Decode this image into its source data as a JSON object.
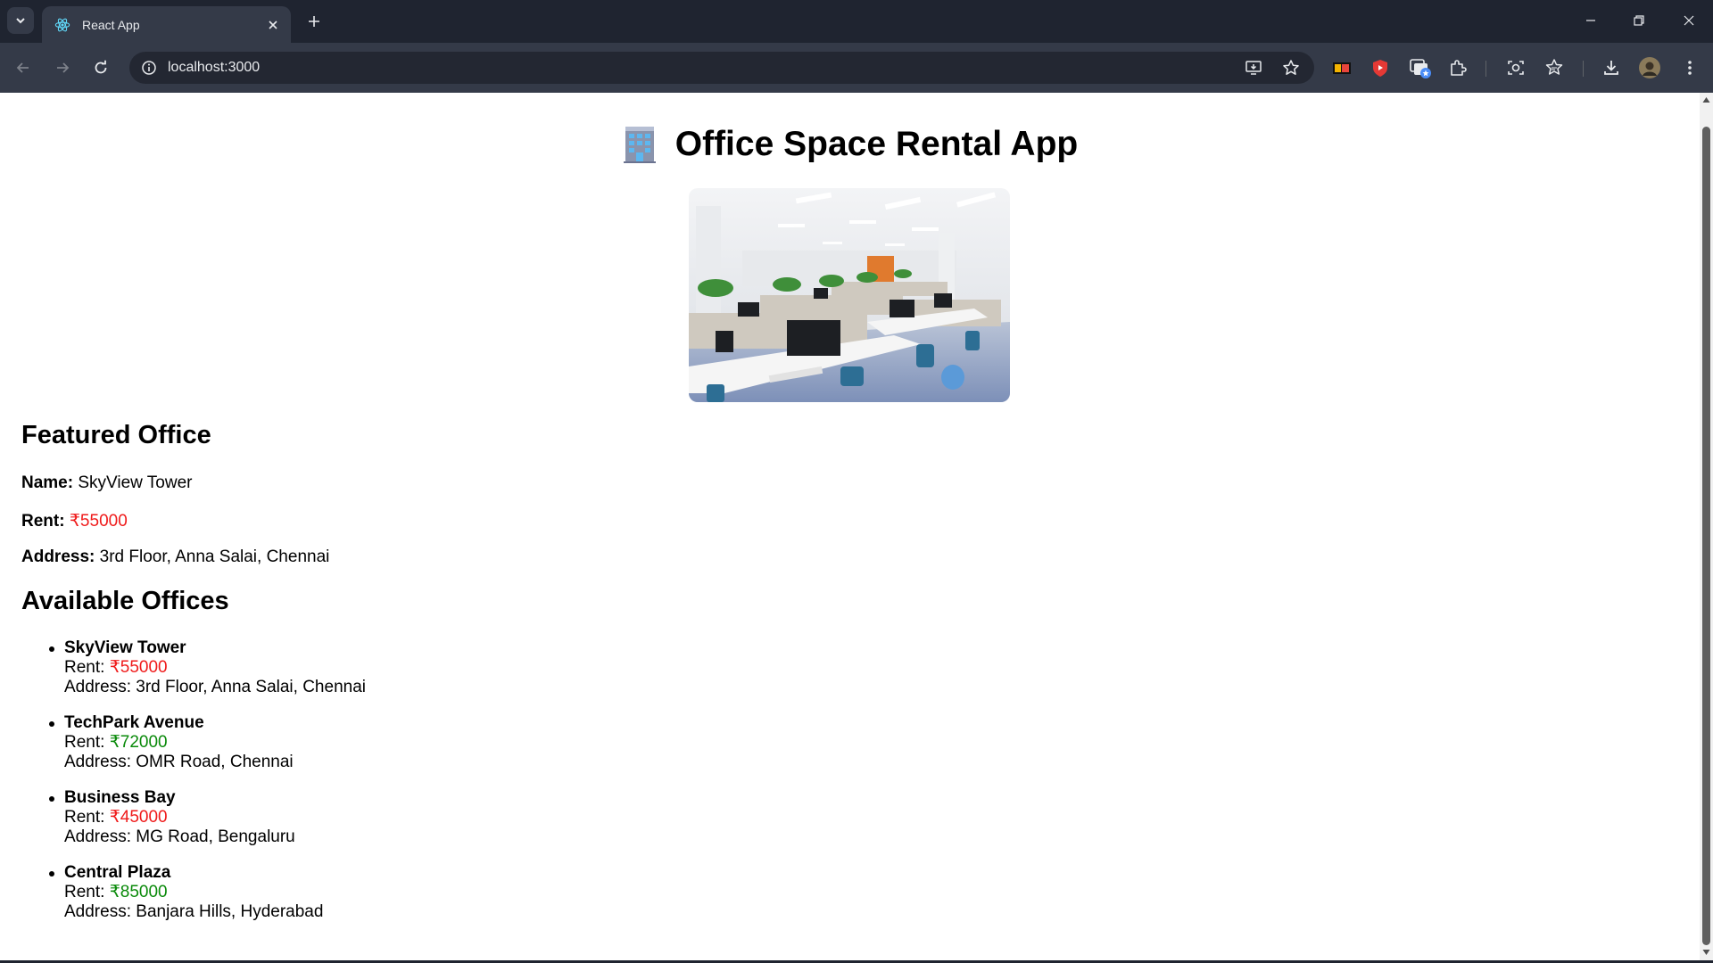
{
  "browser": {
    "tab_title": "React App",
    "url": "localhost:3000"
  },
  "page": {
    "title": "Office Space Rental App",
    "featured_heading": "Featured Office",
    "featured": {
      "name_label": "Name:",
      "name": "SkyView Tower",
      "rent_label": "Rent:",
      "rent": "₹55000",
      "address_label": "Address:",
      "address": "3rd Floor, Anna Salai, Chennai"
    },
    "available_heading": "Available Offices",
    "rent_prefix": "Rent: ",
    "address_prefix": "Address: ",
    "offices": [
      {
        "name": "SkyView Tower",
        "rent": "₹55000",
        "rent_color": "#ef1b1b",
        "address": "3rd Floor, Anna Salai, Chennai"
      },
      {
        "name": "TechPark Avenue",
        "rent": "₹72000",
        "rent_color": "#0a8a0a",
        "address": "OMR Road, Chennai"
      },
      {
        "name": "Business Bay",
        "rent": "₹45000",
        "rent_color": "#ef1b1b",
        "address": "MG Road, Bengaluru"
      },
      {
        "name": "Central Plaza",
        "rent": "₹85000",
        "rent_color": "#0a8a0a",
        "address": "Banjara Hills, Hyderabad"
      }
    ]
  },
  "colors": {
    "rent_low": "#ef1b1b",
    "rent_high": "#0a8a0a",
    "chrome_dark": "#1f2430",
    "chrome_toolbar": "#343a48"
  }
}
